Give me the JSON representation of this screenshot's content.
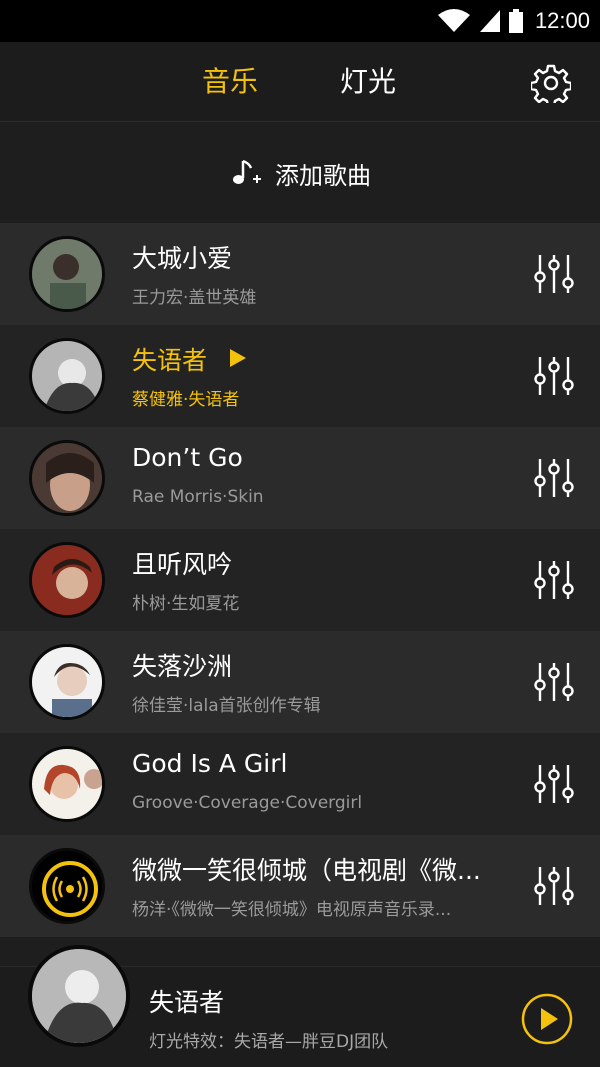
{
  "status": {
    "time": "12:00"
  },
  "header": {
    "tabs": [
      {
        "label": "音乐",
        "active": true
      },
      {
        "label": "灯光",
        "active": false
      }
    ]
  },
  "add_song": {
    "label": "添加歌曲"
  },
  "songs": [
    {
      "title": "大城小爱",
      "subtitle": "王力宏·盖世英雄",
      "playing": false
    },
    {
      "title": "失语者",
      "subtitle": "蔡健雅·失语者",
      "playing": true
    },
    {
      "title": "Don’t  Go",
      "subtitle": "Rae Morris·Skin",
      "playing": false
    },
    {
      "title": "且听风吟",
      "subtitle": "朴树·生如夏花",
      "playing": false
    },
    {
      "title": "失落沙洲",
      "subtitle": "徐佳莹·lala首张创作专辑",
      "playing": false
    },
    {
      "title": "God Is A Girl",
      "subtitle": "Groove·Coverage·Covergirl",
      "playing": false
    },
    {
      "title": "微微一笑很倾城（电视剧《微...",
      "subtitle": "杨洋·《微微一笑很倾城》电视原声音乐录...",
      "playing": false
    }
  ],
  "now_playing": {
    "title": "失语者",
    "subtitle": "灯光特效：失语者—胖豆DJ团队"
  },
  "colors": {
    "accent": "#f4c20d",
    "background": "#1e1e1e",
    "row_light": "#2b2b2b",
    "row_dark": "#232323"
  },
  "icons": {
    "settings": "gear-icon",
    "add": "music-note-plus-icon",
    "row_action": "equalizer-sliders-icon",
    "play": "play-icon"
  }
}
